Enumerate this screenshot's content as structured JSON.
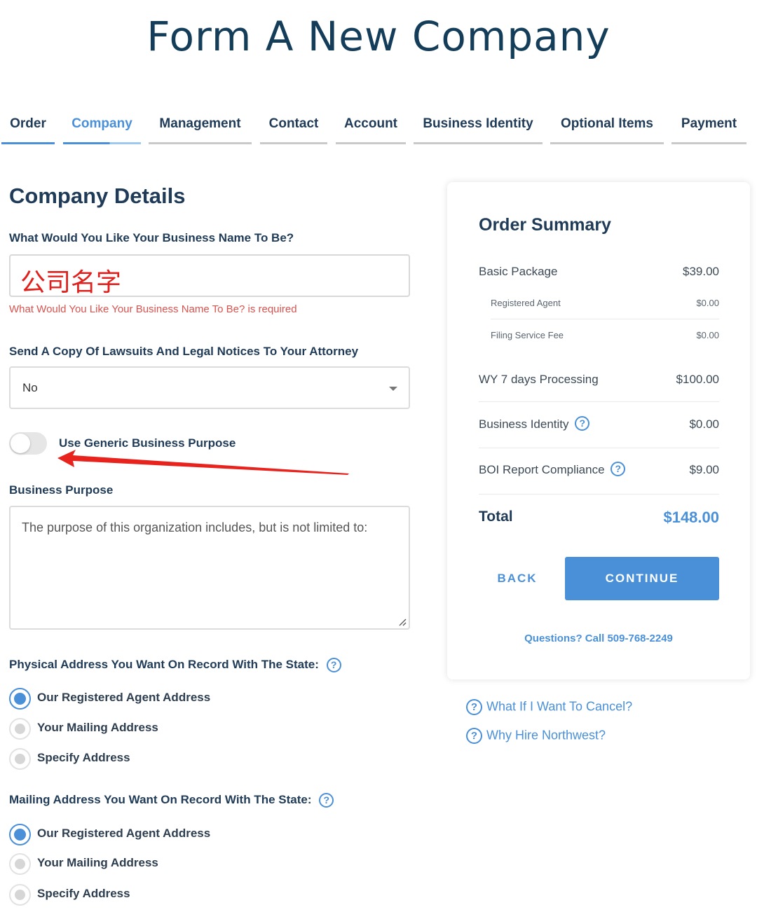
{
  "page": {
    "title": "Form A New Company"
  },
  "tabs": [
    {
      "label": "Order"
    },
    {
      "label": "Company"
    },
    {
      "label": "Management"
    },
    {
      "label": "Contact"
    },
    {
      "label": "Account"
    },
    {
      "label": "Business Identity"
    },
    {
      "label": "Optional Items"
    },
    {
      "label": "Payment"
    }
  ],
  "company": {
    "section_title": "Company Details",
    "business_name_label": "What Would You Like Your Business Name To Be?",
    "business_name_value": "公司名字",
    "business_name_error": "What Would You Like Your Business Name To Be? is required",
    "attorney_label": "Send A Copy Of Lawsuits And Legal Notices To Your Attorney",
    "attorney_value": "No",
    "generic_purpose_label": "Use Generic Business Purpose",
    "purpose_label": "Business Purpose",
    "purpose_value": "The purpose of this organization includes, but is not limited to:"
  },
  "physical_address": {
    "label": "Physical Address You Want On Record With The State:",
    "options": [
      "Our Registered Agent Address",
      "Your Mailing Address",
      "Specify Address"
    ]
  },
  "mailing_address": {
    "label": "Mailing Address You Want On Record With The State:",
    "options": [
      "Our Registered Agent Address",
      "Your Mailing Address",
      "Specify Address"
    ]
  },
  "summary": {
    "title": "Order Summary",
    "items": [
      {
        "name": "Basic Package",
        "price": "$39.00"
      },
      {
        "name": "Registered Agent",
        "price": "$0.00"
      },
      {
        "name": "Filing Service Fee",
        "price": "$0.00"
      },
      {
        "name": "WY 7 days Processing",
        "price": "$100.00"
      },
      {
        "name": "Business Identity",
        "price": "$0.00"
      },
      {
        "name": "BOI Report Compliance",
        "price": "$9.00"
      }
    ],
    "total_label": "Total",
    "total_value": "$148.00",
    "back_label": "BACK",
    "continue_label": "CONTINUE",
    "call_text": "Questions? Call 509-768-2249"
  },
  "help": {
    "cancel": "What If I Want To Cancel?",
    "why": "Why Hire Northwest?"
  },
  "colors": {
    "accent": "#4a90d9",
    "error": "#d9534f",
    "heading": "#1f3b57"
  },
  "icons": {
    "help": "question-circle-icon",
    "dropdown": "chevron-down-icon"
  }
}
